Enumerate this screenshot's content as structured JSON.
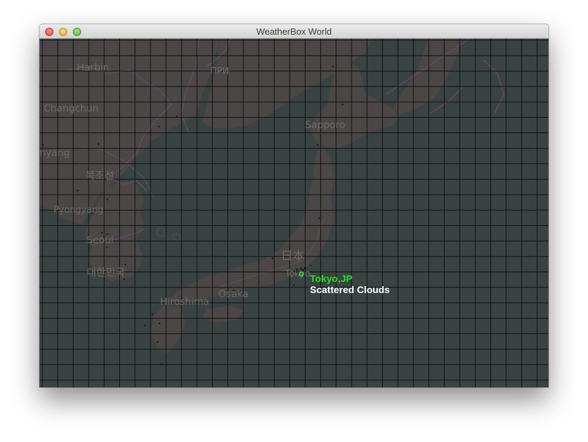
{
  "window": {
    "title": "WeatherBox World"
  },
  "map": {
    "labels": {
      "harbin": "Harbin",
      "changchun": "Changchun",
      "shenyang": "nyang",
      "pyongyang": "Pyongyang",
      "north_korea": "북조선",
      "seoul": "Seoul",
      "south_korea": "대한민국",
      "sapporo": "Sapporo",
      "japan": "日本",
      "tokyo": "Tokyo",
      "osaka": "Osaka",
      "hiroshima": "Hiroshima",
      "russia_fragment": "ПРИ"
    }
  },
  "selected_city": {
    "name": "Tokyo,JP",
    "condition": "Scattered Clouds",
    "name_color": "#21e321"
  }
}
